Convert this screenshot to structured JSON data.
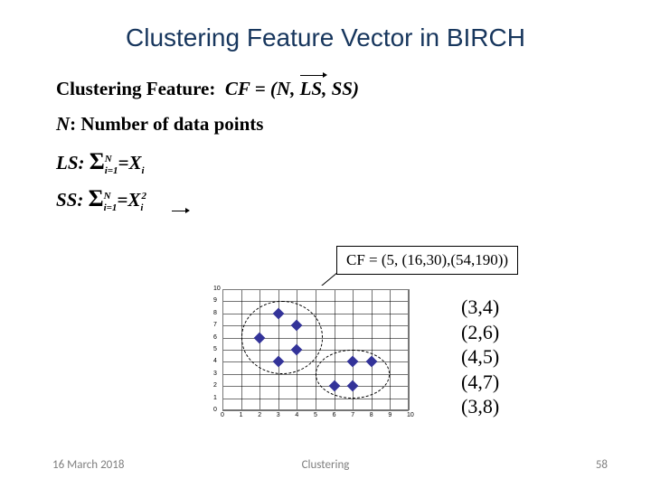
{
  "title": "Clustering Feature Vector in BIRCH",
  "cf_label": "Clustering Feature:",
  "cf_formula_prefix": "CF = (N, ",
  "cf_formula_ls": "LS",
  "cf_formula_suffix": ", SS)",
  "n_line_prefix": "N",
  "n_line_rest": ": Number of data points",
  "ls_label": "LS: ",
  "ls_sup": "N",
  "ls_sub": "i=1",
  "ls_eq": "=X",
  "ls_xsub": "i",
  "ss_label": "SS: ",
  "ss_sup": "N",
  "ss_sub": "i=1",
  "ss_eq": "=X",
  "ss_xsub": "i",
  "ss_xsup": "2",
  "cf_box": "CF = (5, (16,30),(54,190))",
  "points": [
    "(3,4)",
    "(2,6)",
    "(4,5)",
    "(4,7)",
    "(3,8)"
  ],
  "chart_data": {
    "type": "scatter",
    "x": [
      3,
      2,
      4,
      4,
      3,
      6,
      7,
      7,
      8
    ],
    "y": [
      4,
      6,
      5,
      7,
      8,
      2,
      2,
      4,
      4
    ],
    "clusters": [
      {
        "cx": 3.2,
        "cy": 6,
        "rx": 2.2,
        "ry": 3.0
      },
      {
        "cx": 7.0,
        "cy": 3,
        "rx": 2.0,
        "ry": 2.0
      }
    ],
    "xlim": [
      0,
      10
    ],
    "ylim": [
      0,
      10
    ],
    "xticks": [
      0,
      1,
      2,
      3,
      4,
      5,
      6,
      7,
      8,
      9,
      10
    ],
    "yticks": [
      0,
      1,
      2,
      3,
      4,
      5,
      6,
      7,
      8,
      9,
      10
    ],
    "title": "",
    "xlabel": "",
    "ylabel": ""
  },
  "footer": {
    "date": "16 March 2018",
    "mid": "Clustering",
    "num": "58"
  }
}
